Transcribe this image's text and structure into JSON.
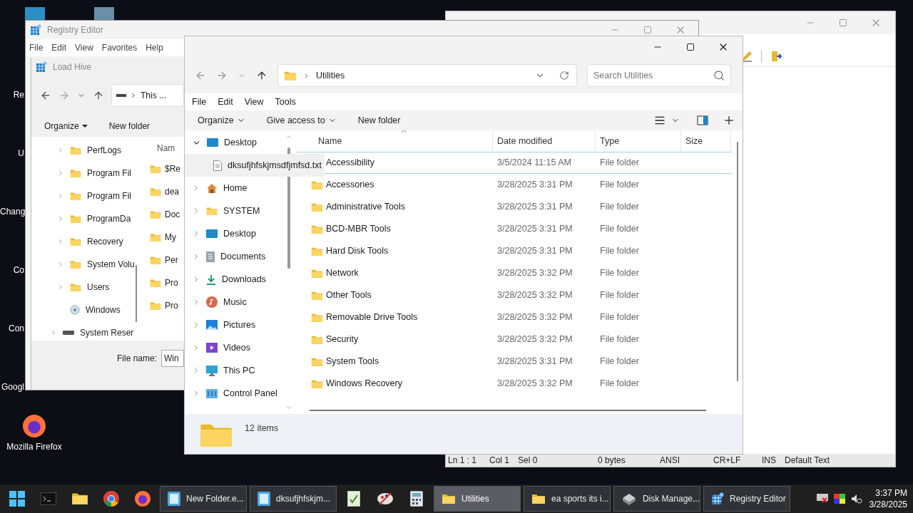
{
  "desktop_labels": [
    "Re",
    "U",
    "Chang",
    "Co",
    "Con",
    "Googl"
  ],
  "desktop_firefox": {
    "label": "Mozilla Firefox"
  },
  "notepad": {
    "status": [
      "Ln 1 : 1",
      "Col 1",
      "Sel 0",
      "0 bytes",
      "ANSI",
      "CR+LF",
      "INS",
      "Default Text"
    ]
  },
  "registry": {
    "title": "Registry Editor",
    "menu": [
      "File",
      "Edit",
      "View",
      "Favorites",
      "Help"
    ],
    "dialog": {
      "title": "Load Hive",
      "address": "This ...",
      "commands": [
        "Organize",
        "New folder"
      ],
      "tree": [
        {
          "label": "PerfLogs",
          "kind": "folder"
        },
        {
          "label": "Program Fil",
          "kind": "folder"
        },
        {
          "label": "Program Fil",
          "kind": "folder"
        },
        {
          "label": "ProgramDa",
          "kind": "folder"
        },
        {
          "label": "Recovery",
          "kind": "folder"
        },
        {
          "label": "System Volu",
          "kind": "folder"
        },
        {
          "label": "Users",
          "kind": "folder"
        },
        {
          "label": "Windows",
          "kind": "windows"
        },
        {
          "label": "System Reser",
          "kind": "drive"
        }
      ],
      "column": "Nam",
      "files": [
        "$Re",
        "dea",
        "Doc",
        "My",
        "Per",
        "Pro",
        "Pro"
      ],
      "file_name_label": "File name:",
      "file_name_value": "Win"
    }
  },
  "explorer": {
    "address": "Utilities",
    "search_placeholder": "Search Utilities",
    "menu": [
      "File",
      "Edit",
      "View",
      "Tools"
    ],
    "commands": [
      {
        "label": "Organize",
        "dropdown": true
      },
      {
        "label": "Give access to",
        "dropdown": true
      },
      {
        "label": "New folder",
        "dropdown": false
      }
    ],
    "tree": [
      {
        "label": "Desktop",
        "kind": "desktop",
        "expanded": true,
        "hovered": false,
        "children": [
          {
            "label": "dksufjhfskjmsdfjmfsd.txt",
            "kind": "file",
            "hovered": true
          }
        ]
      },
      {
        "label": "Home",
        "kind": "home",
        "expanded": false,
        "hovered": false
      },
      {
        "label": "SYSTEM",
        "kind": "folder",
        "expanded": false,
        "hovered": false
      },
      {
        "label": "Desktop",
        "kind": "desktop",
        "expanded": false,
        "hovered": false
      },
      {
        "label": "Documents",
        "kind": "documents",
        "expanded": false,
        "hovered": false
      },
      {
        "label": "Downloads",
        "kind": "downloads",
        "expanded": false,
        "hovered": false
      },
      {
        "label": "Music",
        "kind": "music",
        "expanded": false,
        "hovered": false
      },
      {
        "label": "Pictures",
        "kind": "pictures",
        "expanded": false,
        "hovered": false
      },
      {
        "label": "Videos",
        "kind": "videos",
        "expanded": false,
        "hovered": false
      },
      {
        "label": "This PC",
        "kind": "pc",
        "expanded": false,
        "hovered": false
      },
      {
        "label": "Control Panel",
        "kind": "control",
        "expanded": false,
        "hovered": false
      }
    ],
    "columns": [
      "Name",
      "Date modified",
      "Type",
      "Size"
    ],
    "rows": [
      {
        "name": "Accessibility",
        "date": "3/5/2024 11:15 AM",
        "type": "File folder",
        "selected": true
      },
      {
        "name": "Accessories",
        "date": "3/28/2025 3:31 PM",
        "type": "File folder",
        "selected": false
      },
      {
        "name": "Administrative Tools",
        "date": "3/28/2025 3:31 PM",
        "type": "File folder",
        "selected": false
      },
      {
        "name": "BCD-MBR Tools",
        "date": "3/28/2025 3:31 PM",
        "type": "File folder",
        "selected": false
      },
      {
        "name": "Hard Disk Tools",
        "date": "3/28/2025 3:31 PM",
        "type": "File folder",
        "selected": false
      },
      {
        "name": "Network",
        "date": "3/28/2025 3:32 PM",
        "type": "File folder",
        "selected": false
      },
      {
        "name": "Other Tools",
        "date": "3/28/2025 3:32 PM",
        "type": "File folder",
        "selected": false
      },
      {
        "name": "Removable Drive Tools",
        "date": "3/28/2025 3:32 PM",
        "type": "File folder",
        "selected": false
      },
      {
        "name": "Security",
        "date": "3/28/2025 3:32 PM",
        "type": "File folder",
        "selected": false
      },
      {
        "name": "System Tools",
        "date": "3/28/2025 3:31 PM",
        "type": "File folder",
        "selected": false
      },
      {
        "name": "Windows Recovery",
        "date": "3/28/2025 3:32 PM",
        "type": "File folder",
        "selected": false
      }
    ],
    "status": "12 items"
  },
  "taskbar": {
    "items": [
      {
        "kind": "start"
      },
      {
        "kind": "terminal"
      },
      {
        "kind": "explorer"
      },
      {
        "kind": "chrome"
      },
      {
        "kind": "firefox"
      },
      {
        "kind": "notepad_window",
        "label": "New Folder.e...",
        "active": false
      },
      {
        "kind": "notepad_window",
        "label": "dksufjhfskjm...",
        "active": false
      },
      {
        "kind": "editor"
      },
      {
        "kind": "paint"
      },
      {
        "kind": "calculator"
      },
      {
        "kind": "folder_window",
        "label": "Utilities",
        "active": true
      },
      {
        "kind": "folder_window",
        "label": "ea sports its i...",
        "active": false
      },
      {
        "kind": "disk_window",
        "label": "Disk Manage...",
        "active": false
      },
      {
        "kind": "registry_window",
        "label": "Registry Editor",
        "active": false
      }
    ],
    "time": "3:37 PM",
    "date": "3/28/2025"
  }
}
